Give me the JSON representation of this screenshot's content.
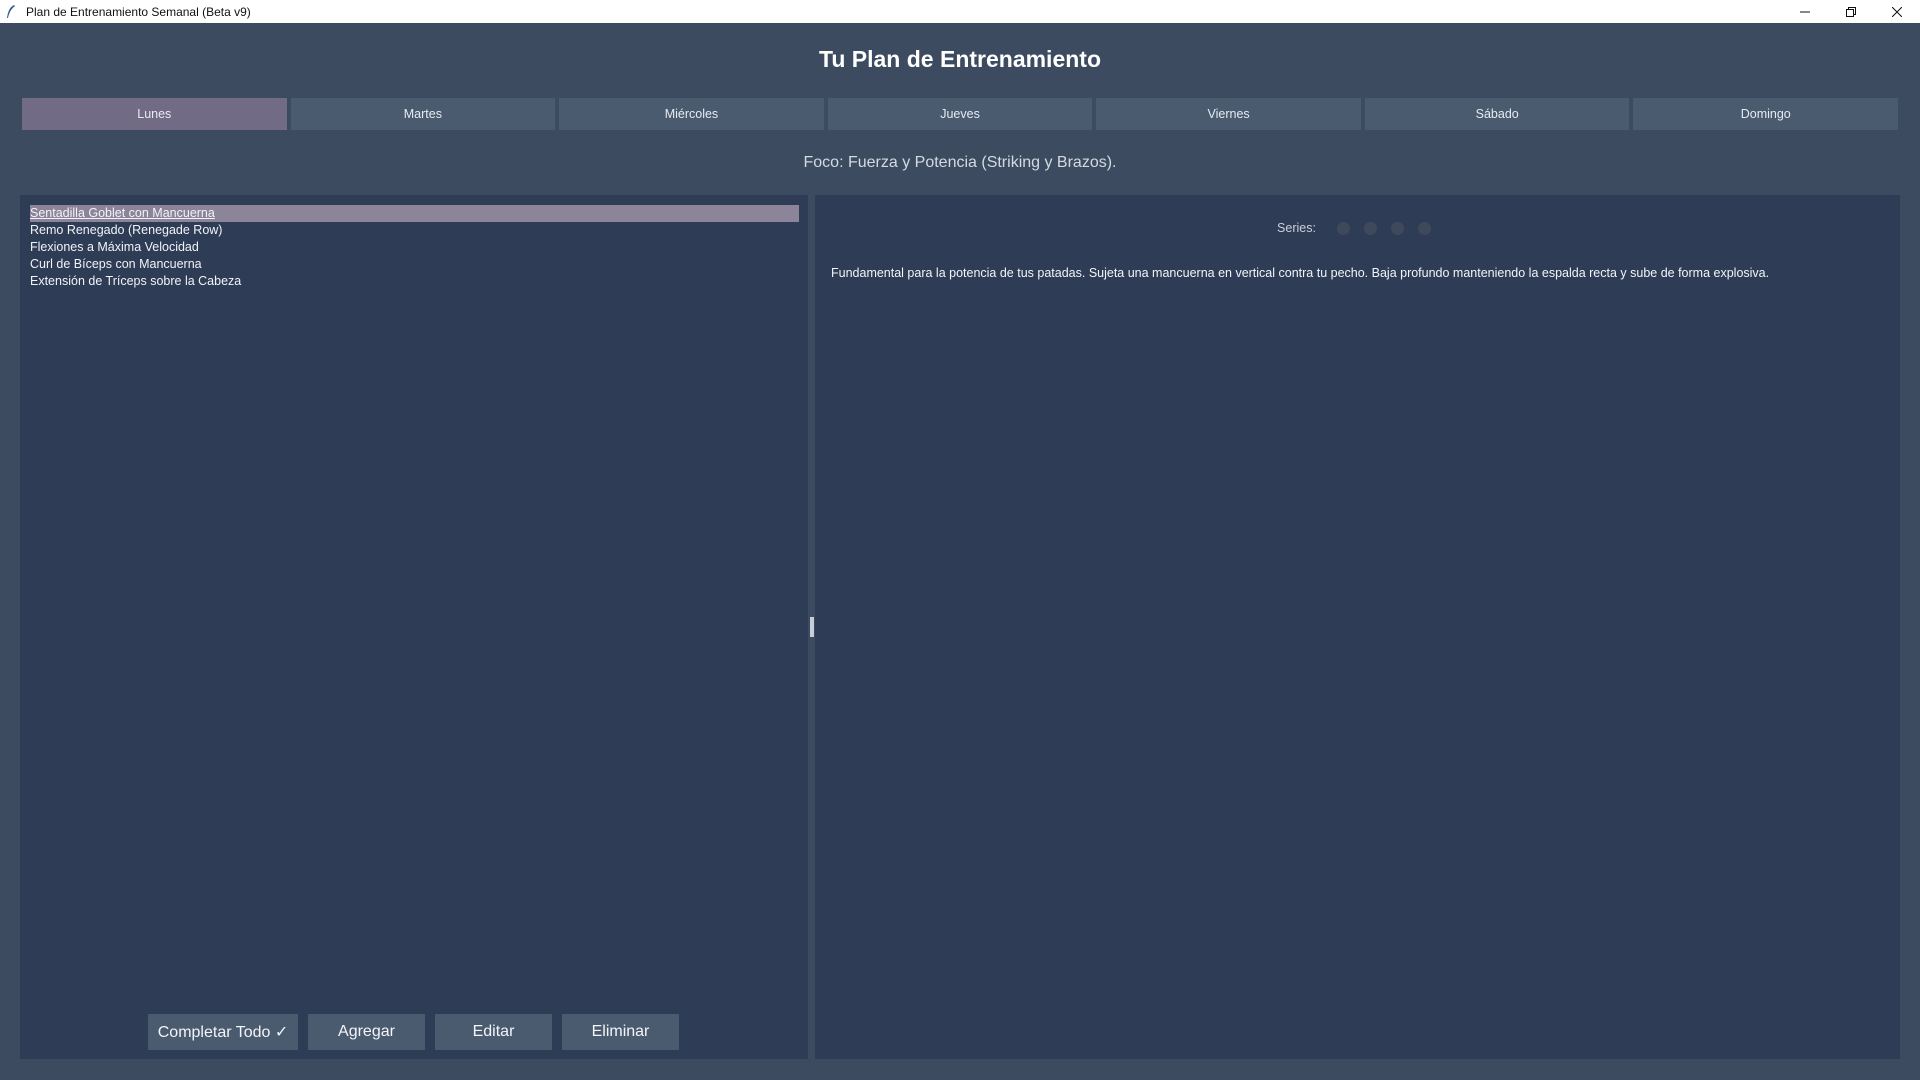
{
  "window": {
    "title": "Plan de Entrenamiento Semanal (Beta v9)"
  },
  "header": {
    "title": "Tu Plan de Entrenamiento"
  },
  "tabs": [
    {
      "label": "Lunes",
      "active": true
    },
    {
      "label": "Martes",
      "active": false
    },
    {
      "label": "Miércoles",
      "active": false
    },
    {
      "label": "Jueves",
      "active": false
    },
    {
      "label": "Viernes",
      "active": false
    },
    {
      "label": "Sábado",
      "active": false
    },
    {
      "label": "Domingo",
      "active": false
    }
  ],
  "focus": "Foco: Fuerza y Potencia (Striking y Brazos).",
  "exercises": [
    {
      "name": "Sentadilla Goblet con Mancuerna",
      "selected": true
    },
    {
      "name": "Remo Renegado (Renegade Row)",
      "selected": false
    },
    {
      "name": "Flexiones a Máxima Velocidad",
      "selected": false
    },
    {
      "name": "Curl de Bíceps con Mancuerna",
      "selected": false
    },
    {
      "name": "Extensión de Tríceps sobre la Cabeza",
      "selected": false
    }
  ],
  "buttons": {
    "complete_all": "Completar Todo ✓",
    "add": "Agregar",
    "edit": "Editar",
    "delete": "Eliminar"
  },
  "detail": {
    "series_label": "Series:",
    "series_count": 4,
    "series_completed": 0,
    "description": "Fundamental para la potencia de tus patadas. Sujeta una mancuerna en vertical contra tu pecho. Baja profundo manteniendo la espalda recta y sube de forma explosiva."
  },
  "colors": {
    "background": "#3c4b5f",
    "panel": "#2e3d55",
    "tab": "#4b5b6f",
    "tab_active": "#726b85",
    "selection": "#8c8499",
    "series_dot": "#3e4a5b"
  }
}
